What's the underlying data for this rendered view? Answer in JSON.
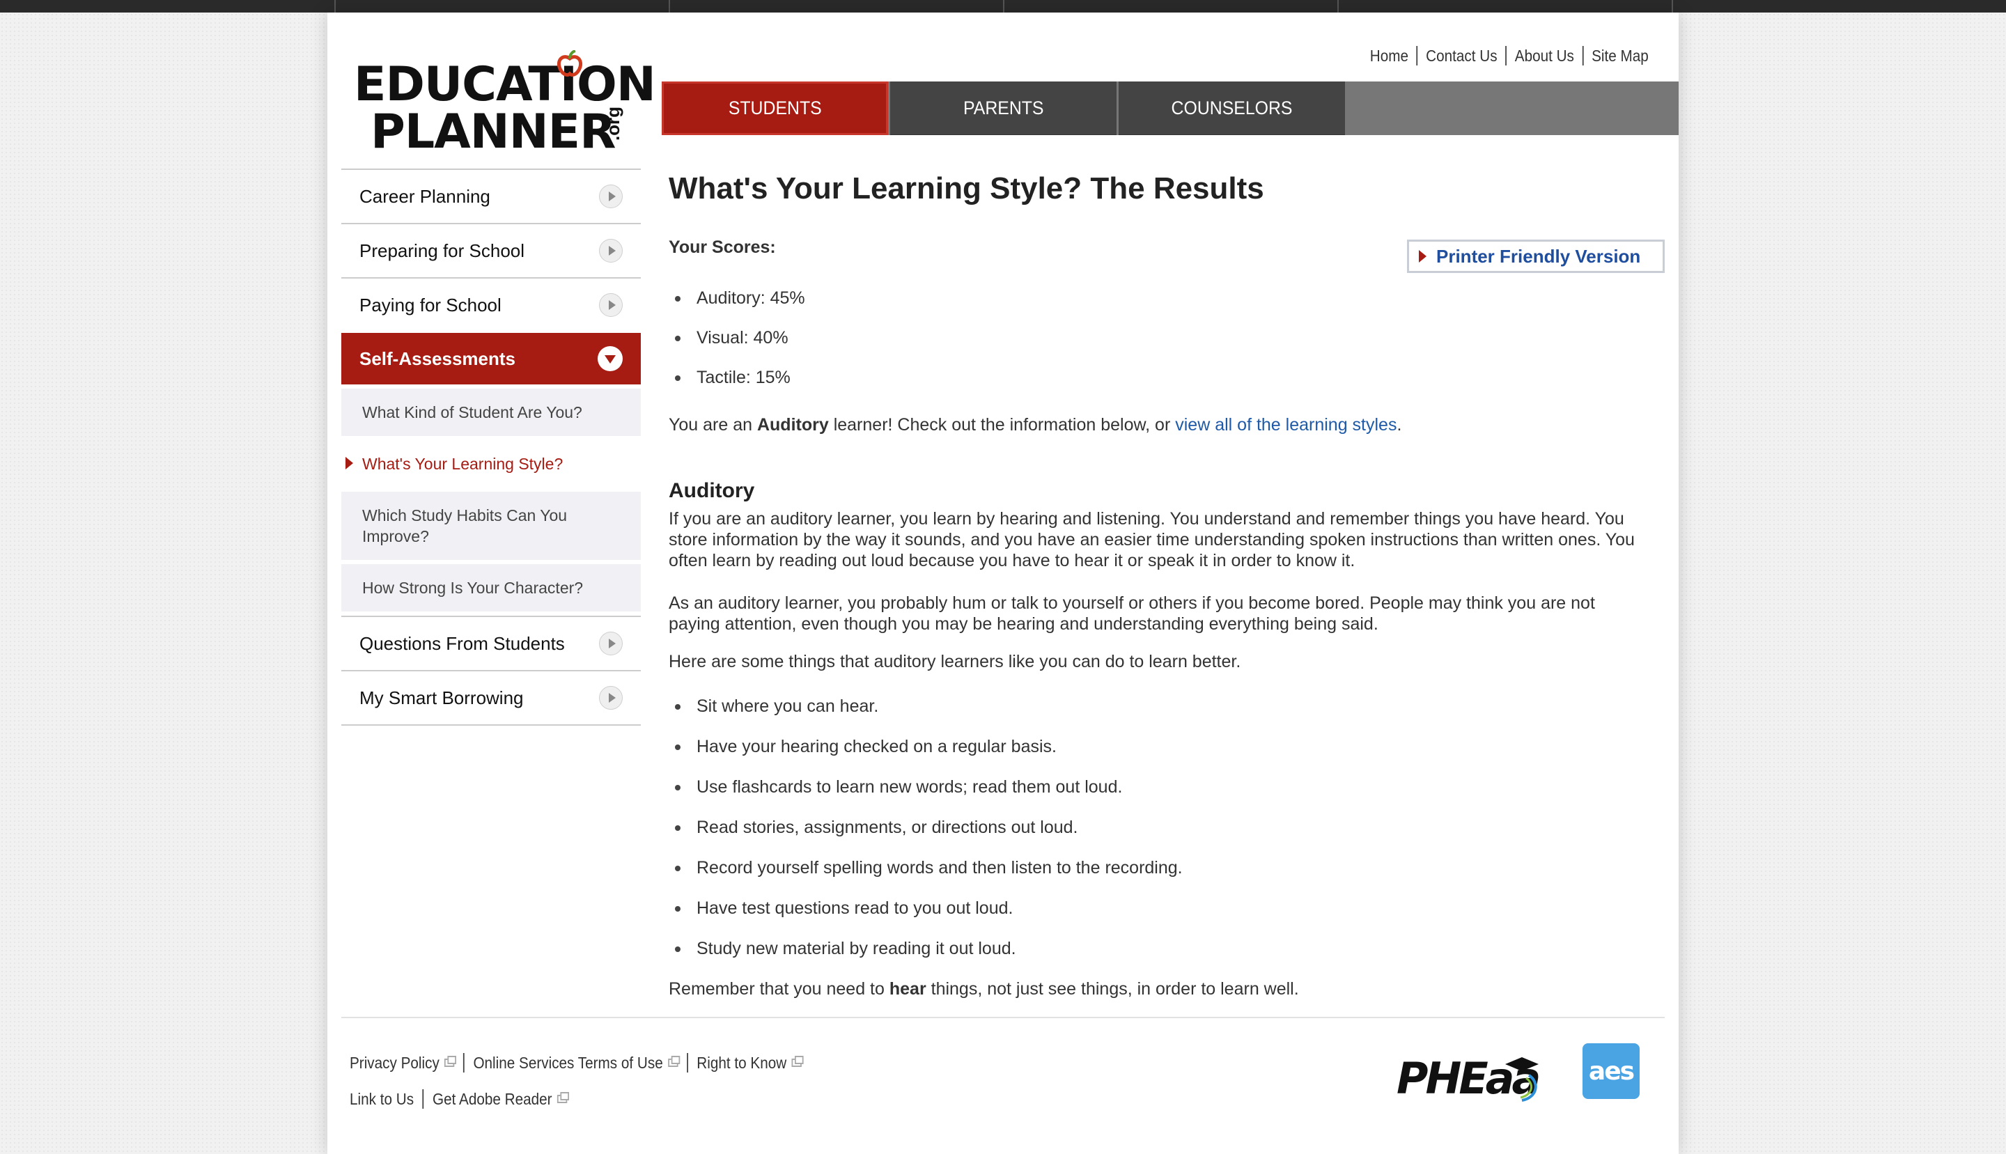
{
  "logo": {
    "line1": "EDUCATION",
    "line2": "PLANNER",
    "suffix": ".org"
  },
  "utility_nav": [
    "Home",
    "Contact Us",
    "About Us",
    "Site Map"
  ],
  "main_nav": [
    "STUDENTS",
    "PARENTS",
    "COUNSELORS"
  ],
  "sidebar": {
    "items": [
      "Career Planning",
      "Preparing for School",
      "Paying for School"
    ],
    "active": "Self-Assessments",
    "subitems": [
      "What Kind of Student Are You?",
      "What's Your Learning Style?",
      "Which Study Habits Can You Improve?",
      "How Strong Is Your Character?"
    ],
    "items_after": [
      "Questions From Students",
      "My Smart Borrowing"
    ]
  },
  "content": {
    "title": "What's Your Learning Style? The Results",
    "scores_label": "Your Scores:",
    "printer_label": "Printer Friendly Version",
    "scores": [
      "Auditory: 45%",
      "Visual: 40%",
      "Tactile: 15%"
    ],
    "result": {
      "prefix": "You are an ",
      "style": "Auditory",
      "middle": " learner! Check out the information below, or ",
      "link": "view all of the learning styles",
      "suffix": "."
    },
    "section_title": "Auditory",
    "para1": "If you are an auditory learner, you learn by hearing and listening. You understand and remember things you have heard. You store information by the way it sounds, and you have an easier time understanding spoken instructions than written ones. You often learn by reading out loud because you have to hear it or speak it in order to know it.",
    "para2": "As an auditory learner, you probably hum or talk to yourself or others if you become bored. People may think you are not paying attention, even though you may be hearing and understanding everything being said.",
    "para3": "Here are some things that auditory learners like you can do to learn better.",
    "tips": [
      "Sit where you can hear.",
      "Have your hearing checked on a regular basis.",
      "Use flashcards to learn new words; read them out loud.",
      "Read stories, assignments, or directions out loud.",
      "Record yourself spelling words and then listen to the recording.",
      "Have test questions read to you out loud.",
      "Study new material by reading it out loud."
    ],
    "closing": {
      "prefix": "Remember that you need to ",
      "bold": "hear",
      "suffix": " things, not just see things, in order to learn well."
    }
  },
  "footer": {
    "row1": [
      "Privacy Policy",
      "Online Services Terms of Use",
      "Right to Know"
    ],
    "row2": [
      "Link to Us",
      "Get Adobe Reader"
    ],
    "logo1": "PHEaa",
    "logo2": "aes"
  },
  "colors": {
    "brand_red": "#a61c12",
    "link_blue": "#1f5aa8",
    "nav_gray": "#444444"
  }
}
